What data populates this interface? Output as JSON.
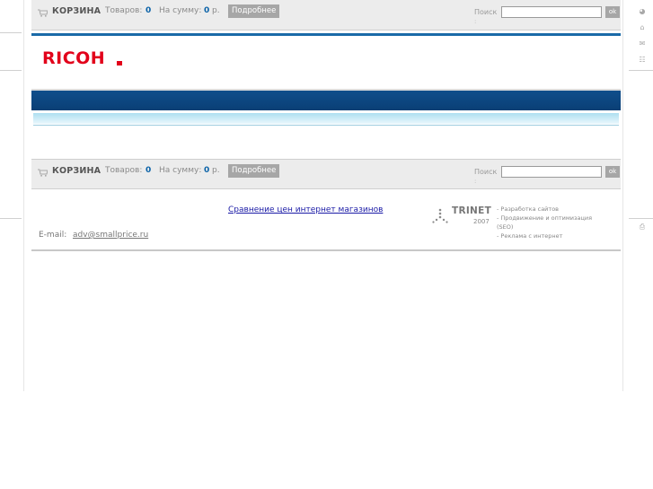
{
  "cart": {
    "title": "КОРЗИНА",
    "items_label": "Товаров:",
    "items_count": "0",
    "sum_label": "На сумму:",
    "sum_value": "0",
    "currency": "р.",
    "more_button": "Подробнее"
  },
  "search": {
    "label": "Поиск",
    "colon": ":",
    "placeholder": "",
    "button": "ok"
  },
  "brand": {
    "logo_text": "RICOH",
    "logo_color": "#e2001a"
  },
  "footer": {
    "compare_link": "Сравнение цен интернет магазинов",
    "email_label": "E-mail:",
    "email": "adv@smallprice.ru",
    "developer": "TRINET",
    "year": "2007",
    "services": [
      "- Разработка сайтов",
      "- Продвижение и оптимизация",
      "(SEO)",
      "- Реклама с интернет"
    ]
  },
  "right_rail_icons": [
    "home-page-icon",
    "home-icon",
    "mail-icon",
    "sitemap-icon",
    "print-icon"
  ],
  "colors": {
    "accent_blue": "#1a6aa8",
    "banner_dark": "#0f4e8c",
    "banner_light": "#aedff0",
    "count_blue": "#0b63a8",
    "bar_bg": "#ececec"
  }
}
